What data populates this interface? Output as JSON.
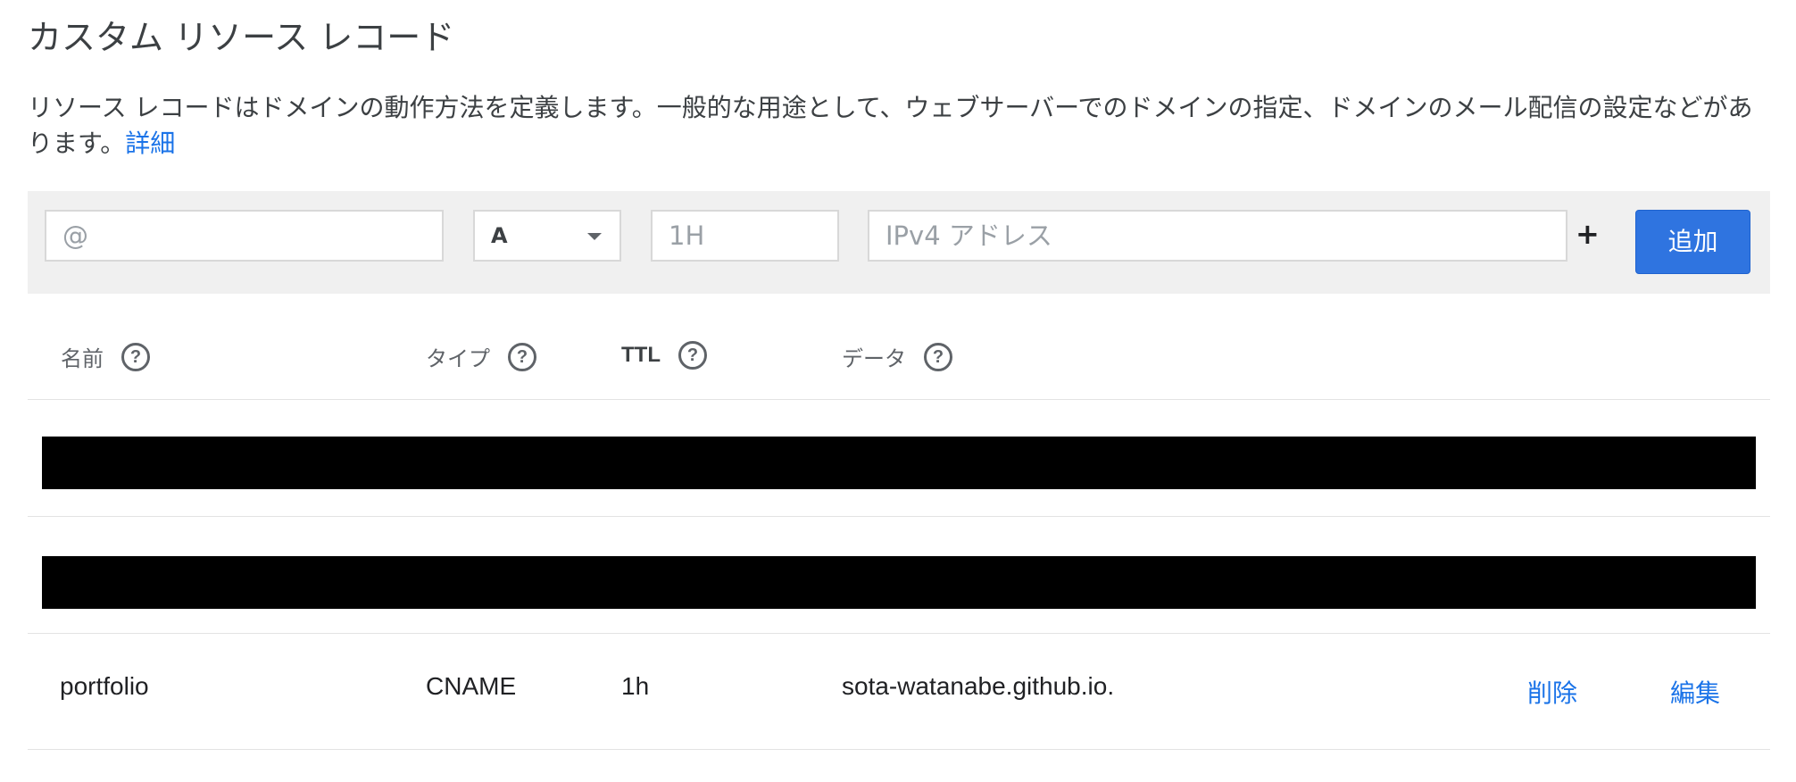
{
  "section": {
    "title": "カスタム リソース レコード",
    "description": "リソース レコードはドメインの動作方法を定義します。一般的な用途として、ウェブサーバーでのドメインの指定、ドメインのメール配信の設定などがあります。",
    "learn_more": "詳細"
  },
  "form": {
    "name_placeholder": "@",
    "type_value": "A",
    "ttl_placeholder": "1H",
    "data_placeholder": "IPv4 アドレス",
    "plus_label": "+",
    "add_label": "追加"
  },
  "table": {
    "headers": {
      "name": "名前",
      "type": "タイプ",
      "ttl": "TTL",
      "data": "データ"
    },
    "help_glyph": "?",
    "rows": [
      {
        "name": "portfolio",
        "type": "CNAME",
        "ttl": "1h",
        "data": "sota-watanabe.github.io.",
        "delete_label": "削除",
        "edit_label": "編集"
      }
    ]
  },
  "colors": {
    "accent": "#2f74e0",
    "link": "#1a73e8",
    "form_background": "#f0f0f0",
    "redaction": "#000000"
  },
  "icons": [
    "help-circle-icon",
    "dropdown-caret-icon",
    "plus-icon"
  ]
}
